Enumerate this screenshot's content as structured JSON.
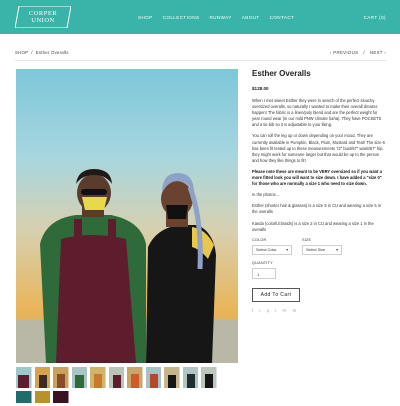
{
  "brand": {
    "line1": "CORPER",
    "line2": "UNION"
  },
  "nav": {
    "items": [
      "SHOP",
      "COLLECTIONS",
      "RUNWAY",
      "ABOUT",
      "CONTACT"
    ],
    "cart": "CART (0)"
  },
  "breadcrumb": {
    "shop": "SHOP",
    "sep": "/",
    "current": "Esther Overalls"
  },
  "pager": {
    "prev": "‹ PREVIOUS",
    "sep": "/",
    "next": "NEXT ›"
  },
  "product": {
    "title": "Esther Overalls",
    "price": "$128.00",
    "desc1": "When I met sweet Esther they were in search of the perfect slouchy oversized overalls, so naturally I wanted to make their overall dreams happen! The fabric is a linen/poly blend and are the perfect weight for year round wear (in our mild PNW climate haha). They have POCKETS and a tie bib so it is adjustable to your liking.",
    "desc2": "You can roll the leg up or down depending on your mood. They are currently available in Pumpkin, Black, Plum, Mustard and Teal! The size 6 has been fit tested up to these measurements 72\" bust/67\" waist/67\" hip, they might work for someone larger but that would be up to the person and how they like things to fit!",
    "desc_bold": "Please note these are meant to be VERY oversized so if you want a more fitted look you will want to size down. I have added a \"size 0\" for those who are normally a size 1 who need to size down.",
    "desc3": "In the photos...",
    "desc4": "Esther (shorter hair & glasses) is a size 5 in CU and wearing a size 5 in the overalls",
    "desc5": "Kanda (colorful braids) is a size 2 in CU and wearing a size 1 in the overalls",
    "color_label": "COLOR",
    "color_value": "Select Color",
    "size_label": "SIZE",
    "size_value": "Select Size",
    "qty_label": "QUANTITY",
    "qty_value": "1",
    "add_label": "Add To Cart"
  },
  "share": {
    "icons": [
      "facebook-icon",
      "twitter-icon",
      "pinterest-icon",
      "tumblr-icon",
      "email-icon",
      "share-icon"
    ]
  },
  "colors": {
    "header": "#3ab4a8"
  }
}
